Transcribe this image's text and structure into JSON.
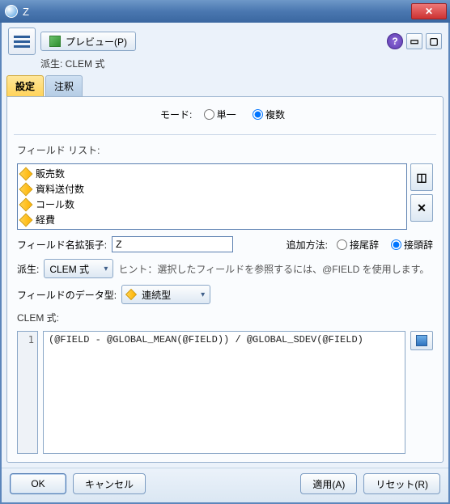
{
  "window": {
    "title": "Z",
    "close_glyph": "✕"
  },
  "header": {
    "preview_label": "プレビュー(P)",
    "subtitle": "派生: CLEM 式"
  },
  "toolbar_icons": {
    "help": "?",
    "minimize": "▭",
    "maximize": "▢"
  },
  "tabs": {
    "settings": "設定",
    "annotation": "注釈"
  },
  "mode": {
    "label": "モード:",
    "single": "単一",
    "multiple": "複数",
    "selected": "multiple"
  },
  "fieldlist": {
    "label": "フィールド リスト:",
    "items": [
      "販売数",
      "資料送付数",
      "コール数",
      "経費"
    ],
    "picker_glyph": "◫",
    "clear_glyph": "✕"
  },
  "extension": {
    "label": "フィールド名拡張子:",
    "value": "Z"
  },
  "add_method": {
    "label": "追加方法:",
    "suffix": "接尾辞",
    "prefix": "接頭辞",
    "selected": "prefix"
  },
  "derive": {
    "label": "派生:",
    "selected": "CLEM 式"
  },
  "hint": "ヒント：選択したフィールドを参照するには、@FIELD を使用します。",
  "datatype": {
    "label": "フィールドのデータ型:",
    "selected": "連続型"
  },
  "expression": {
    "label": "CLEM 式:",
    "line_number": "1",
    "code": "(@FIELD - @GLOBAL_MEAN(@FIELD)) / @GLOBAL_SDEV(@FIELD)"
  },
  "footer": {
    "ok": "OK",
    "cancel": "キャンセル",
    "apply": "適用(A)",
    "reset": "リセット(R)"
  }
}
